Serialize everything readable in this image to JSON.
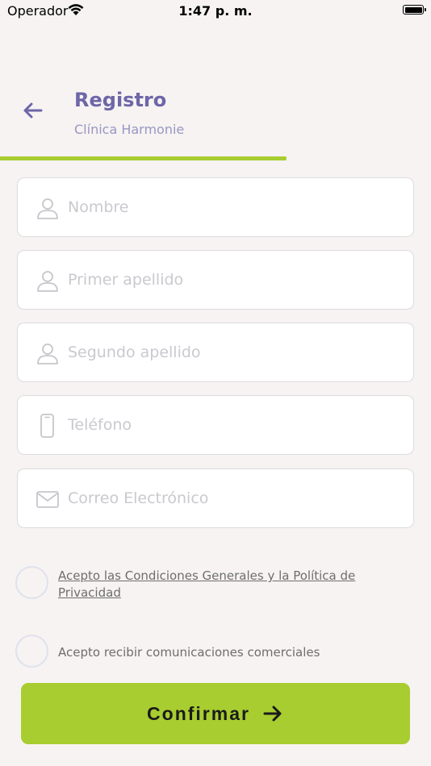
{
  "status_bar": {
    "carrier": "Operador",
    "time": "1:47 p. m."
  },
  "header": {
    "title": "Registro",
    "subtitle": "Clínica Harmonie"
  },
  "progress": {
    "value": 0.665,
    "color": "#a8cd30"
  },
  "form": {
    "fields": [
      {
        "name": "nombre",
        "placeholder": "Nombre",
        "icon": "person-icon",
        "value": ""
      },
      {
        "name": "primer-apellido",
        "placeholder": "Primer apellido",
        "icon": "person-icon",
        "value": ""
      },
      {
        "name": "segundo-apellido",
        "placeholder": "Segundo apellido",
        "icon": "person-icon",
        "value": ""
      },
      {
        "name": "telefono",
        "placeholder": "Teléfono",
        "icon": "phone-icon",
        "value": ""
      },
      {
        "name": "correo",
        "placeholder": "Correo Electrónico",
        "icon": "mail-icon",
        "value": ""
      }
    ]
  },
  "consents": {
    "terms": {
      "line1": "Acepto las Condiciones Generales y la Política de",
      "line2": "Privacidad",
      "checked": false
    },
    "marketing": {
      "label": "Acepto recibir comunicaciones comerciales",
      "checked": false
    }
  },
  "actions": {
    "confirm_label": "Confirmar"
  },
  "colors": {
    "accent": "#a8cd30",
    "title": "#6d66a8",
    "subtitle": "#9a96c4",
    "background": "#f6f3f2"
  }
}
